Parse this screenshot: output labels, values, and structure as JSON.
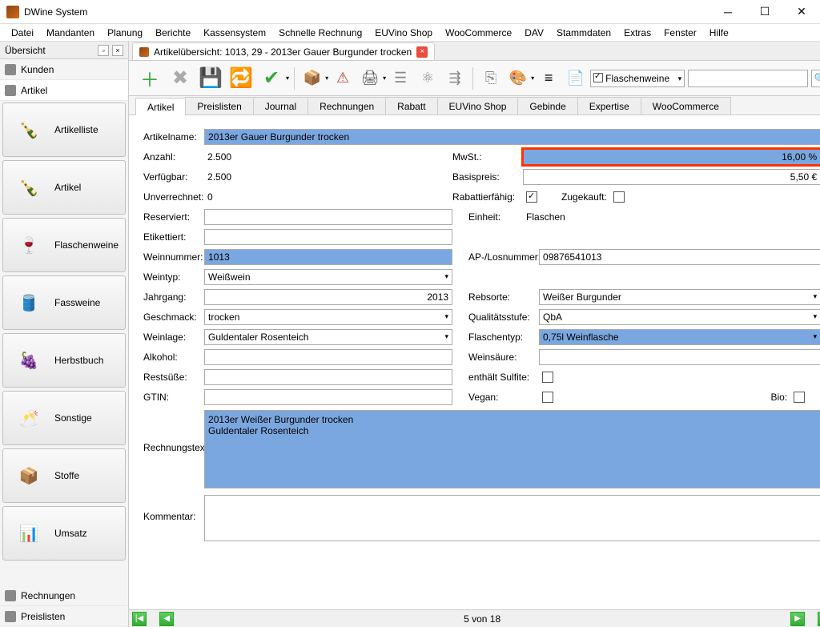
{
  "window": {
    "title": "DWine System"
  },
  "menu": [
    "Datei",
    "Mandanten",
    "Planung",
    "Berichte",
    "Kassensystem",
    "Schnelle Rechnung",
    "EUVino Shop",
    "WooCommerce",
    "DAV",
    "Stammdaten",
    "Extras",
    "Fenster",
    "Hilfe"
  ],
  "sidebar": {
    "title": "Übersicht",
    "small": [
      "Kunden",
      "Artikel"
    ],
    "big": [
      "Artikelliste",
      "Artikel",
      "Flaschenweine",
      "Fassweine",
      "Herbstbuch",
      "Sonstige",
      "Stoffe",
      "Umsatz"
    ],
    "bottom": [
      "Rechnungen",
      "Preislisten"
    ]
  },
  "doctab": {
    "label": "Artikelübersicht: 1013, 29 - 2013er Gauer Burgunder trocken"
  },
  "toolbar_combo": "Flaschenweine",
  "subtabs": [
    "Artikel",
    "Preislisten",
    "Journal",
    "Rechnungen",
    "Rabatt",
    "EUVino Shop",
    "Gebinde",
    "Expertise",
    "WooCommerce"
  ],
  "form": {
    "artikelname_l": "Artikelname:",
    "artikelname": "2013er Gauer Burgunder trocken",
    "anzahl_l": "Anzahl:",
    "anzahl": "2.500",
    "mwst_l": "MwSt.:",
    "mwst": "16,00 %",
    "verfuegbar_l": "Verfügbar:",
    "verfuegbar": "2.500",
    "basispreis_l": "Basispreis:",
    "basispreis": "5,50 €",
    "unverrechnet_l": "Unverrechnet:",
    "unverrechnet": "0",
    "rabatt_l": "Rabattierfähig:",
    "zugekauft_l": "Zugekauft:",
    "reserviert_l": "Reserviert:",
    "einheit_l": "Einheit:",
    "einheit": "Flaschen",
    "etikettiert_l": "Etikettiert:",
    "weinnummer_l": "Weinnummer:",
    "weinnummer": "1013",
    "aplos_l": "AP-/Losnummer:",
    "aplos": "09876541013",
    "weintyp_l": "Weintyp:",
    "weintyp": "Weißwein",
    "jahrgang_l": "Jahrgang:",
    "jahrgang": "2013",
    "rebsorte_l": "Rebsorte:",
    "rebsorte": "Weißer Burgunder",
    "geschmack_l": "Geschmack:",
    "geschmack": "trocken",
    "qualitaet_l": "Qualitätsstufe:",
    "qualitaet": "QbA",
    "weinlage_l": "Weinlage:",
    "weinlage": "Guldentaler Rosenteich",
    "flaschentyp_l": "Flaschentyp:",
    "flaschentyp": "0,75l Weinflasche",
    "alkohol_l": "Alkohol:",
    "weinsaeure_l": "Weinsäure:",
    "restsuesse_l": "Restsüße:",
    "sulfite_l": "enthält Sulfite:",
    "gtin_l": "GTIN:",
    "vegan_l": "Vegan:",
    "bio_l": "Bio:",
    "rechnungstext_l": "Rechnungstext:",
    "rechnungstext": "2013er Weißer Burgunder trocken\nGuldentaler Rosenteich",
    "kommentar_l": "Kommentar:"
  },
  "pager": {
    "text": "5 von 18"
  }
}
